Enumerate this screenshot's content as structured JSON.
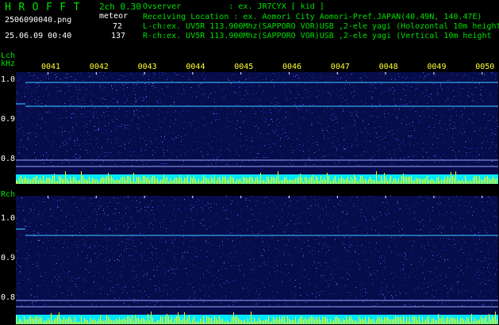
{
  "header": {
    "brand": "HROFFT",
    "channel_info": "2ch 0.30",
    "event_type": "meteor",
    "count_lch": "72",
    "count_rch": "137",
    "filename": "2506090040.png",
    "datetime": "25.06.09 00:40",
    "observer_line": "Ovserver          : ex. JR7CYX [ kid ]",
    "location_line": "Receiving Location : ex. Aomori City Aomori-Pref.JAPAN(40.49N, 140.47E)",
    "lch_line": "L-ch:ex. UV5R 113.900Mhz(SAPPORO VOR)USB ,2-ele yagi (Holozontal 10m height",
    "rch_line": "R-ch:ex. UV5R 113.900Mhz(SAPPORO VOR)USB ,2-ele yagi (Vertical 10m height"
  },
  "lch": {
    "label": "Lch",
    "unit": "kHz"
  },
  "rch": {
    "label": "Rch"
  },
  "time_ticks": [
    "0041",
    "0042",
    "0043",
    "0044",
    "0045",
    "0046",
    "0047",
    "0048",
    "0049",
    "0050"
  ],
  "freq_ticks": [
    "1.0",
    "0.9",
    "0.8"
  ],
  "colors": {
    "header_text": "#00e000",
    "tick_text": "#ffff30",
    "waterfall_bg": "#070c4a",
    "noise": "#2a3cff",
    "signal_line": "#33bbff",
    "level_cyan": "#00e8ff",
    "level_yellow": "#ffff00"
  }
}
